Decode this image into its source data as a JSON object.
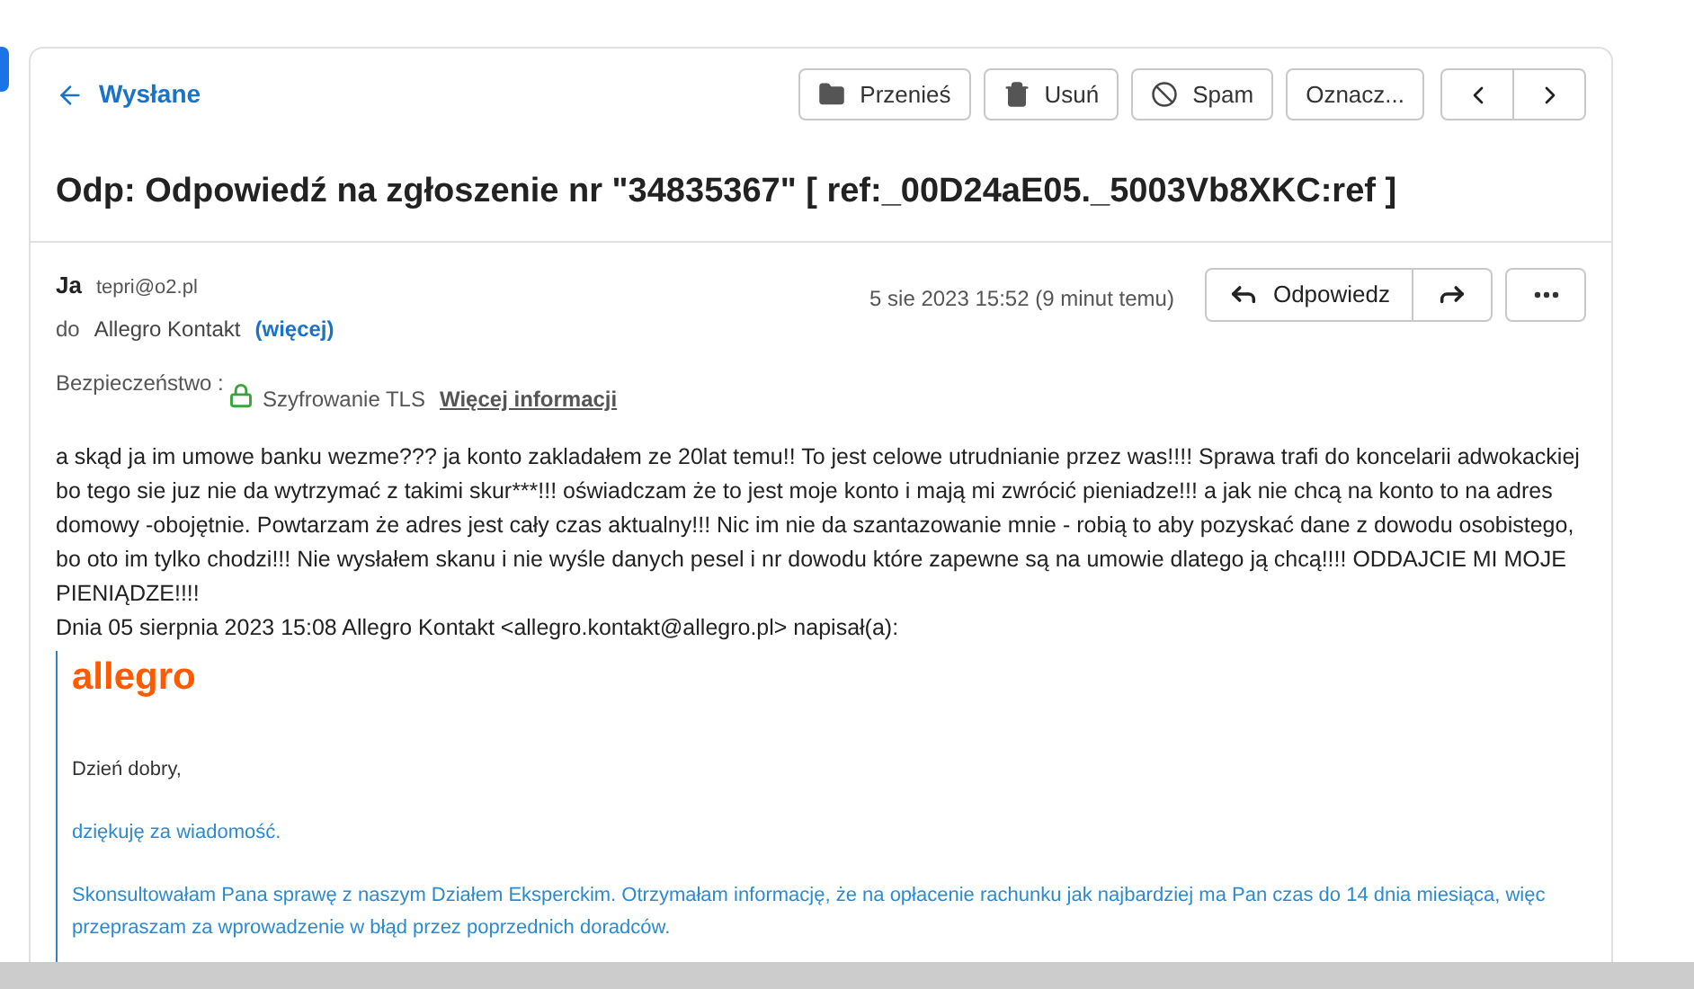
{
  "back_link": "Wysłane",
  "toolbar": [
    {
      "kind": "move",
      "label": "Przenieś"
    },
    {
      "kind": "delete",
      "label": "Usuń"
    },
    {
      "kind": "spam",
      "label": "Spam"
    },
    {
      "kind": "mark",
      "label": "Oznacz..."
    }
  ],
  "subject": "Odp: Odpowiedź na zgłoszenie nr \"34835367\" [ ref:_00D24aE05._5003Vb8XKC:ref ]",
  "sender": {
    "name": "Ja",
    "email": "tepri@o2.pl"
  },
  "recipients": {
    "label": "do",
    "name": "Allegro Kontakt",
    "more": "(więcej)"
  },
  "date": "5 sie 2023 15:52 (9 minut temu)",
  "reply_button": "Odpowiedz",
  "security": {
    "label": "Bezpieczeństwo :",
    "value": "Szyfrowanie TLS",
    "link": "Więcej informacji"
  },
  "body": "a skąd ja im umowe banku wezme??? ja konto  zakladałem ze 20lat temu!! To jest celowe utrudnianie przez was!!!! Sprawa trafi do koncelarii adwokackiej bo tego sie juz nie da wytrzymać z takimi skur***!!! oświadczam że to jest moje konto i mają mi zwrócić pieniadze!!! a jak nie chcą na konto to na adres domowy -obojętnie. Powtarzam że adres jest cały czas aktualny!!! Nic im nie da szantazowanie mnie - robią to aby pozyskać dane z dowodu osobistego, bo oto im tylko chodzi!!! Nie wysłałem skanu i nie wyśle danych pesel i nr dowodu które zapewne są na umowie dlatego ją chcą!!!! ODDAJCIE MI MOJE PIENIĄDZE!!!!",
  "quote_header": "Dnia 05 sierpnia 2023 15:08 Allegro Kontakt <allegro.kontakt@allegro.pl> napisał(a):",
  "quote": {
    "logo": "allegro",
    "paragraphs": [
      {
        "kind": "plain",
        "text": "Dzień dobry,"
      },
      {
        "kind": "accent",
        "text": "dziękuję za wiadomość."
      },
      {
        "kind": "accent",
        "text": "Skonsultowałam Pana sprawę z naszym Działem Eksperckim. Otrzymałam informację, że na opłacenie rachunku jak najbardziej ma Pan czas do 14 dnia miesiąca, więc przepraszam za wprowadzenie w błąd przez poprzednich doradców."
      }
    ]
  }
}
